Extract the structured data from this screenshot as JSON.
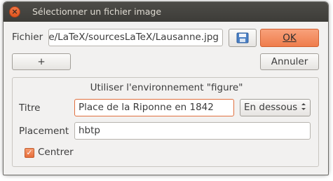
{
  "window": {
    "title": "Sélectionner un fichier image",
    "close_glyph": "×"
  },
  "file": {
    "label": "Fichier",
    "value": "e/LaTeX/sourcesLaTeX/Lausanne.jpg",
    "save_icon": "floppy-disk-icon"
  },
  "buttons": {
    "ok_label": "OK",
    "plus_label": "+",
    "cancel_label": "Annuler"
  },
  "figure_group": {
    "heading": "Utiliser l'environnement \"figure\"",
    "title_label": "Titre",
    "title_value": "Place de la Riponne en 1842",
    "position_value": "En dessous",
    "placement_label": "Placement",
    "placement_value": "hbtp",
    "center_label": "Centrer",
    "center_checked": true
  },
  "colors": {
    "accent": "#ef7d4c",
    "titlebar": "#3d3c38",
    "window_bg": "#f2f1f0"
  }
}
